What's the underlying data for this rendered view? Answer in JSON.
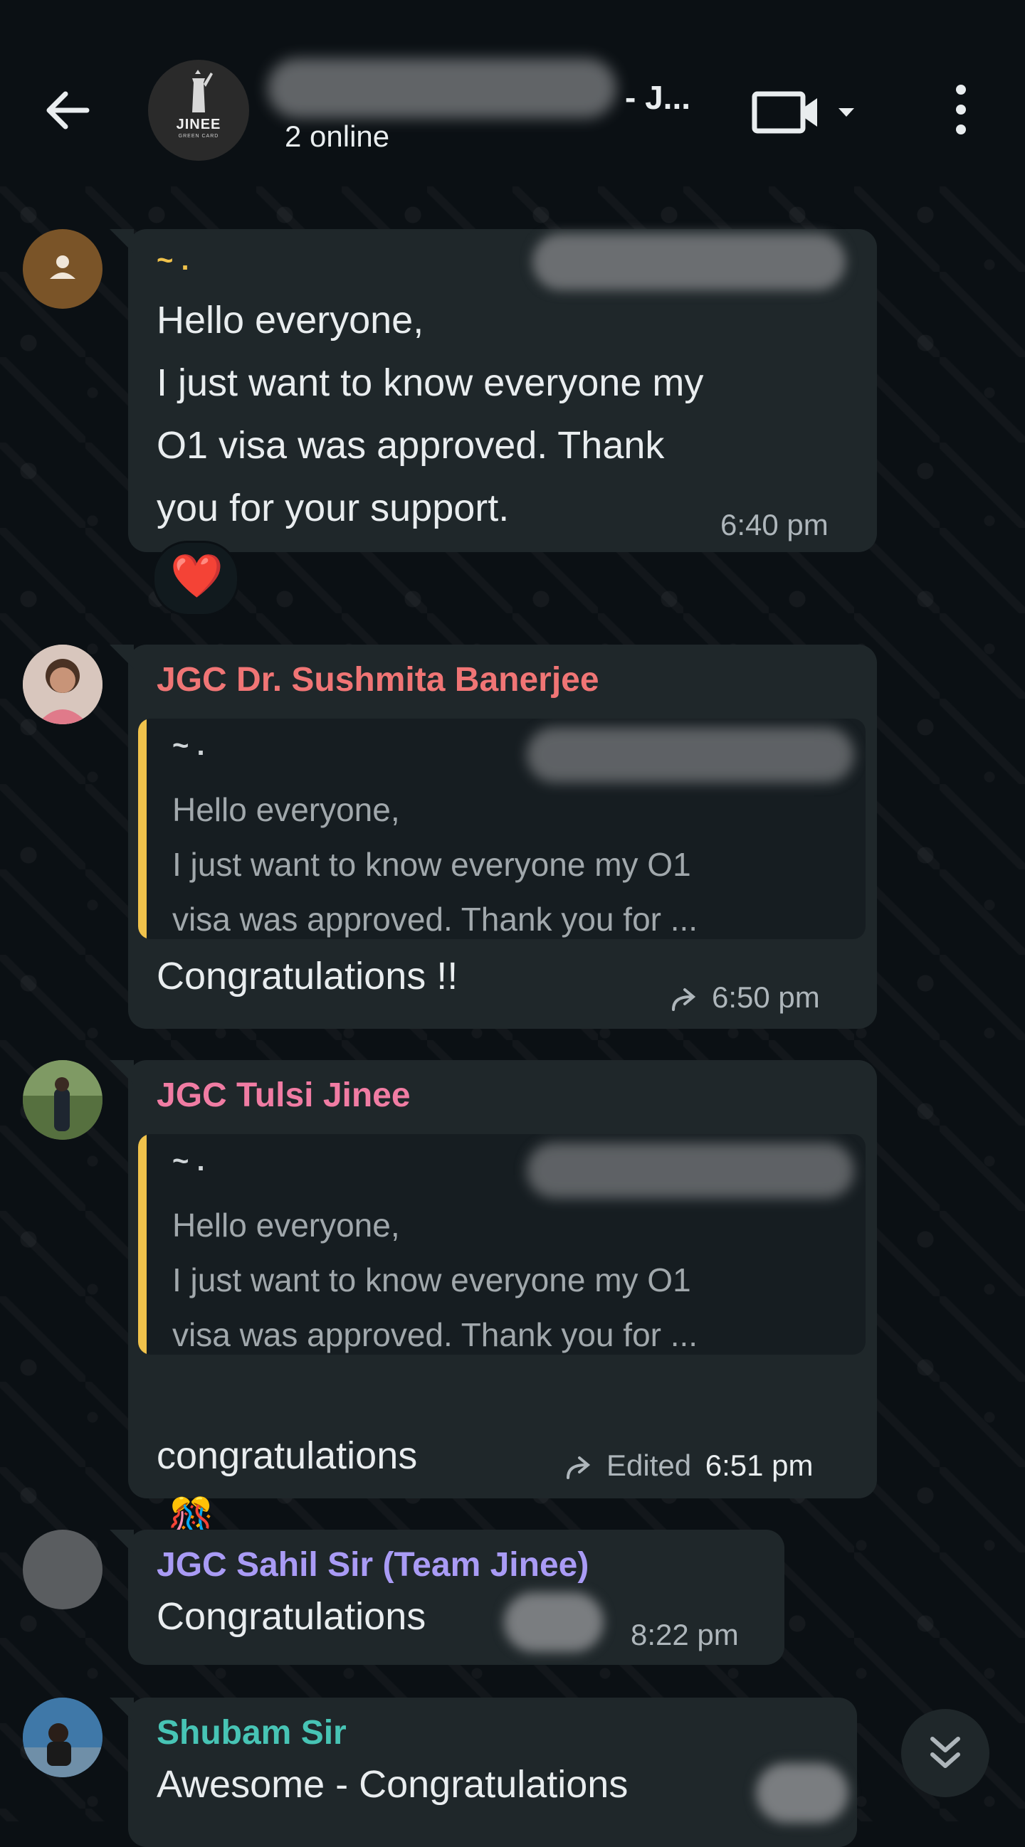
{
  "header": {
    "back_icon": "arrow-left-icon",
    "group_logo_text": "JINEE",
    "group_logo_sub": "GREEN CARD",
    "title_suffix": "- J...",
    "subtitle": "2 online",
    "video_icon": "video-call-icon",
    "dropdown_icon": "caret-down-icon",
    "menu_icon": "more-vertical-icon"
  },
  "colors": {
    "bubble": "#1f272a",
    "quote_bar": "#f0c24b",
    "sender_sushmita": "#f07575",
    "sender_tulsi": "#f07ca3",
    "sender_sahil": "#a99bf5",
    "sender_shubam": "#47c4b5",
    "mention": "#3fcf6a"
  },
  "messages": [
    {
      "sender": "~ .",
      "text": "Hello everyone,\nI just want to know everyone my\nO1 visa was approved. Thank\nyou for your support.",
      "time": "6:40 pm",
      "reaction": "❤️"
    },
    {
      "sender": "JGC Dr. Sushmita Banerjee",
      "quote_sender": "~ .",
      "quote_text": "Hello everyone,\nI just want to know everyone my O1\nvisa was approved. Thank you for ...",
      "text": "Congratulations !!",
      "time": "6:50 pm"
    },
    {
      "sender": "JGC Tulsi Jinee",
      "quote_sender": "~ .",
      "quote_text": "Hello everyone,\nI just want to know everyone my O1\nvisa was approved. Thank you for ...",
      "text": "congratulations",
      "emoji": "🎊",
      "mention": "@~.",
      "edited": "Edited",
      "time": "6:51 pm"
    },
    {
      "sender": "JGC Sahil Sir (Team Jinee)",
      "text": "Congratulations",
      "time": "8:22 pm"
    },
    {
      "sender": "Shubam Sir",
      "text": "Awesome - Congratulations"
    }
  ],
  "scroll_icon": "double-chevron-down-icon"
}
